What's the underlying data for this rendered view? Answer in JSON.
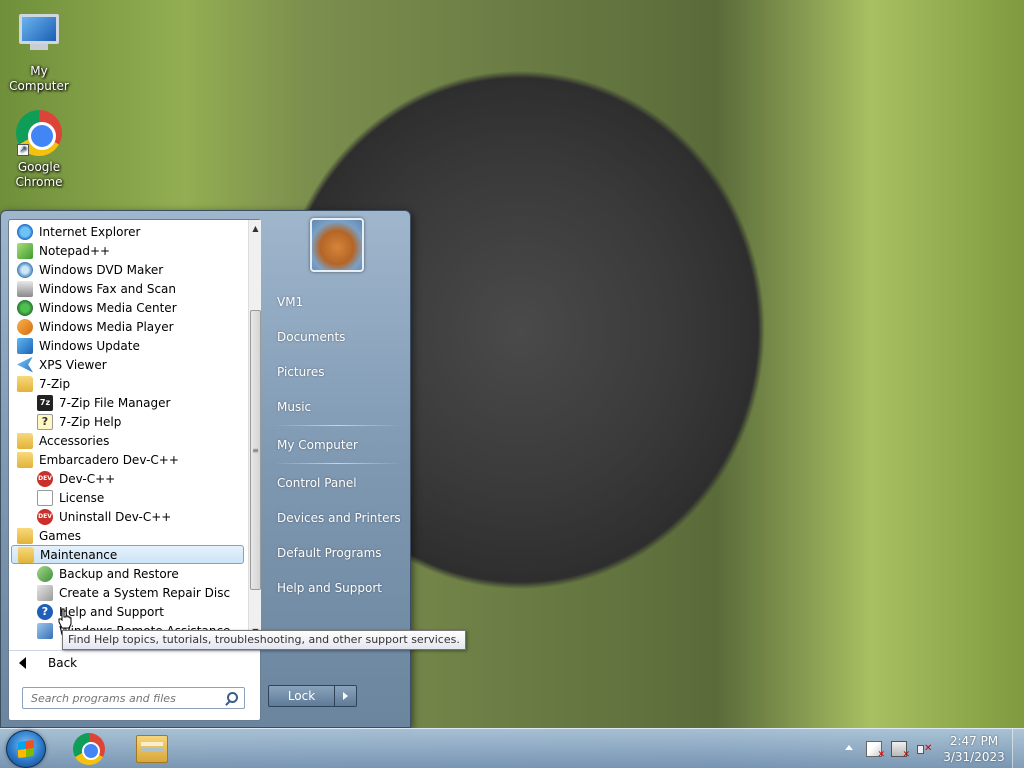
{
  "desktop": {
    "icons": [
      {
        "label": "My Computer"
      },
      {
        "label": "Google Chrome"
      }
    ]
  },
  "start_menu": {
    "programs": [
      {
        "label": "Internet Explorer",
        "icon": "ie-icon"
      },
      {
        "label": "Notepad++",
        "icon": "notepad-plus-plus-icon"
      },
      {
        "label": "Windows DVD Maker",
        "icon": "dvd-maker-icon"
      },
      {
        "label": "Windows Fax and Scan",
        "icon": "fax-scan-icon"
      },
      {
        "label": "Windows Media Center",
        "icon": "media-center-icon"
      },
      {
        "label": "Windows Media Player",
        "icon": "media-player-icon"
      },
      {
        "label": "Windows Update",
        "icon": "windows-update-icon"
      },
      {
        "label": "XPS Viewer",
        "icon": "xps-viewer-icon"
      },
      {
        "label": "7-Zip",
        "icon": "folder-icon"
      },
      {
        "label": "7-Zip File Manager",
        "icon": "7zip-icon"
      },
      {
        "label": "7-Zip Help",
        "icon": "help-file-icon"
      },
      {
        "label": "Accessories",
        "icon": "folder-icon"
      },
      {
        "label": "Embarcadero Dev-C++",
        "icon": "folder-icon"
      },
      {
        "label": "Dev-C++",
        "icon": "dev-cpp-icon"
      },
      {
        "label": "License",
        "icon": "document-icon"
      },
      {
        "label": "Uninstall Dev-C++",
        "icon": "dev-cpp-icon"
      },
      {
        "label": "Games",
        "icon": "folder-icon"
      },
      {
        "label": "Maintenance",
        "icon": "folder-icon"
      },
      {
        "label": "Backup and Restore",
        "icon": "backup-icon"
      },
      {
        "label": "Create a System Repair Disc",
        "icon": "repair-disc-icon"
      },
      {
        "label": "Help and Support",
        "icon": "help-icon"
      },
      {
        "label": "Windows Remote Assistance",
        "icon": "remote-assistance-icon"
      }
    ],
    "selected_program": "Maintenance",
    "back_label": "Back",
    "search_placeholder": "Search programs and files",
    "user_items": [
      {
        "label": "VM1"
      },
      {
        "label": "Documents"
      },
      {
        "label": "Pictures"
      },
      {
        "label": "Music"
      },
      {
        "label": "My Computer"
      },
      {
        "label": "Control Panel"
      },
      {
        "label": "Devices and Printers"
      },
      {
        "label": "Default Programs"
      },
      {
        "label": "Help and Support"
      }
    ],
    "lock_label": "Lock"
  },
  "tooltip": {
    "text": "Find Help topics, tutorials, troubleshooting, and other support services."
  },
  "taskbar": {
    "clock_time": "2:47 PM",
    "clock_date": "3/31/2023"
  }
}
